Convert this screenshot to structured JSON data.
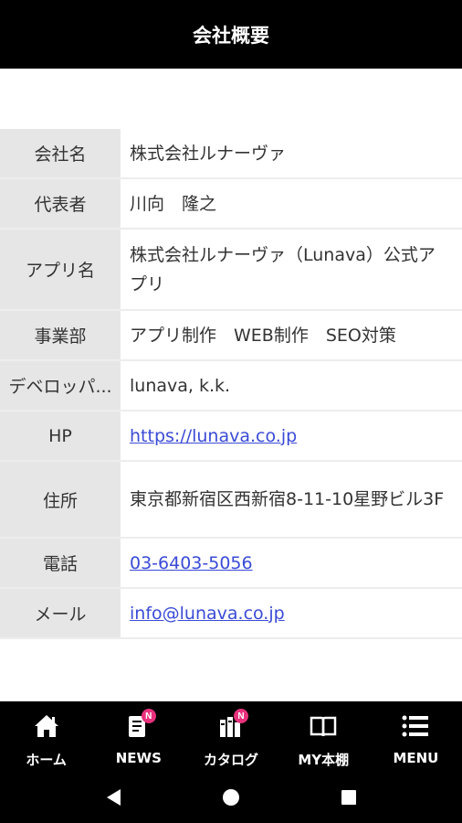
{
  "header": {
    "title": "会社概要"
  },
  "rows": [
    {
      "label": "会社名",
      "value": "株式会社ルナーヴァ"
    },
    {
      "label": "代表者",
      "value": "川向　隆之"
    },
    {
      "label": "アプリ名",
      "value": "株式会社ルナーヴァ（Lunava）公式アプリ"
    },
    {
      "label": "事業部",
      "value": "アプリ制作　WEB制作　SEO対策"
    },
    {
      "label": "デベロッパ...",
      "value": "lunava, k.k."
    },
    {
      "label": "HP",
      "value": "https://lunava.co.jp"
    },
    {
      "label": "住所",
      "value": "東京都新宿区西新宿8-11-10星野ビル3F"
    },
    {
      "label": "電話",
      "value": "03-6403-5056"
    },
    {
      "label": "メール",
      "value": "info@lunava.co.jp"
    }
  ],
  "tabbar": {
    "items": [
      {
        "label": "ホーム",
        "icon": "home-icon"
      },
      {
        "label": "NEWS",
        "icon": "news-icon",
        "badge": "N"
      },
      {
        "label": "カタログ",
        "icon": "catalog-icon",
        "badge": "N"
      },
      {
        "label": "MY本棚",
        "icon": "book-icon"
      },
      {
        "label": "MENU",
        "icon": "menu-icon"
      }
    ]
  },
  "colors": {
    "header_bg": "#000000",
    "link": "#3a4bd6",
    "badge": "#e8317c",
    "label_bg": "#e6e6e6"
  }
}
